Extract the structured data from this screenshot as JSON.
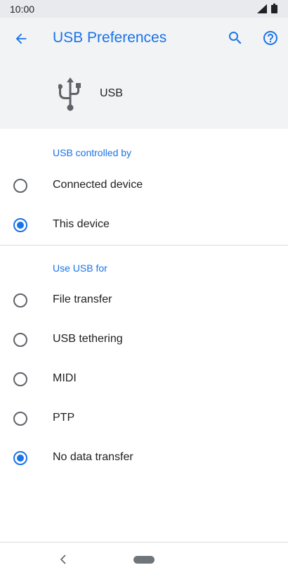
{
  "status_bar": {
    "time": "10:00",
    "signal_icon": "signal-icon",
    "battery_icon": "battery-icon"
  },
  "app_bar": {
    "back_icon": "arrow-back-icon",
    "title": "USB Preferences",
    "search_icon": "search-icon",
    "help_icon": "help-icon"
  },
  "header": {
    "icon": "usb-icon",
    "label": "USB"
  },
  "usb_controlled_by": {
    "title": "USB controlled by",
    "options": [
      {
        "label": "Connected device",
        "checked": false
      },
      {
        "label": "This device",
        "checked": true
      }
    ]
  },
  "use_usb_for": {
    "title": "Use USB for",
    "options": [
      {
        "label": "File transfer",
        "checked": false
      },
      {
        "label": "USB tethering",
        "checked": false
      },
      {
        "label": "MIDI",
        "checked": false
      },
      {
        "label": "PTP",
        "checked": false
      },
      {
        "label": "No data transfer",
        "checked": true
      }
    ]
  },
  "colors": {
    "accent": "#1a73e8",
    "header_bg": "#f1f3f4",
    "status_bg": "#e8eaed"
  }
}
